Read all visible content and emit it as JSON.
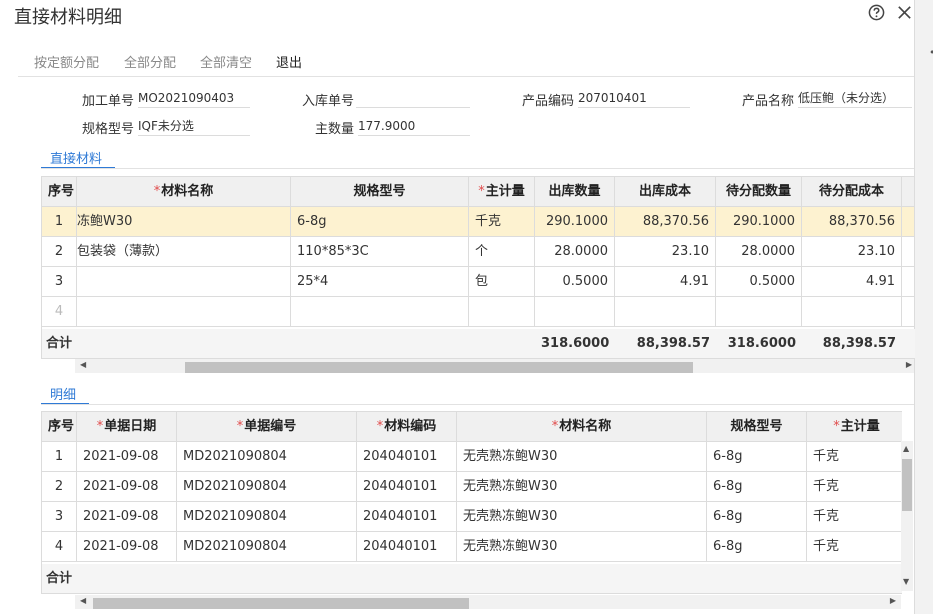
{
  "dialog": {
    "title": "直接材料明细"
  },
  "toolbar": {
    "quota_alloc": "按定额分配",
    "alloc_all": "全部分配",
    "clear_all": "全部清空",
    "exit": "退出"
  },
  "form": {
    "process_no_label": "加工单号",
    "process_no": "MO2021090403",
    "inbound_no_label": "入库单号",
    "inbound_no": "",
    "product_code_label": "产品编码",
    "product_code": "207010401",
    "product_name_label": "产品名称",
    "product_name": "低压鲍（未分选）",
    "spec_label": "规格型号",
    "spec": "IQF未分选",
    "main_qty_label": "主数量",
    "main_qty": "177.9000"
  },
  "materials": {
    "tab": "直接材料",
    "headers": [
      "序号",
      "材料名称",
      "规格型号",
      "主计量",
      "出库数量",
      "出库成本",
      "待分配数量",
      "待分配成本"
    ],
    "rows": [
      [
        "1",
        "冻鲍W30",
        "6-8g",
        "千克",
        "290.1000",
        "88,370.56",
        "290.1000",
        "88,370.56"
      ],
      [
        "2",
        "包装袋（薄款）",
        "110*85*3C",
        "个",
        "28.0000",
        "23.10",
        "28.0000",
        "23.10"
      ],
      [
        "3",
        "",
        "25*4",
        "包",
        "0.5000",
        "4.91",
        "0.5000",
        "4.91"
      ],
      [
        "4",
        "",
        "",
        "",
        "",
        "",
        "",
        ""
      ]
    ],
    "total_label": "合计",
    "totals": [
      "318.6000",
      "88,398.57",
      "318.6000",
      "88,398.57"
    ]
  },
  "details": {
    "tab": "明细",
    "headers": [
      "序号",
      "单据日期",
      "单据编号",
      "材料编码",
      "材料名称",
      "规格型号",
      "主计量"
    ],
    "rows": [
      [
        "1",
        "2021-09-08",
        "MD2021090804",
        "204040101",
        "无壳熟冻鲍W30",
        "6-8g",
        "千克"
      ],
      [
        "2",
        "2021-09-08",
        "MD2021090804",
        "204040101",
        "无壳熟冻鲍W30",
        "6-8g",
        "千克"
      ],
      [
        "3",
        "2021-09-08",
        "MD2021090804",
        "204040101",
        "无壳熟冻鲍W30",
        "6-8g",
        "千克"
      ],
      [
        "4",
        "2021-09-08",
        "MD2021090804",
        "204040101",
        "无壳熟冻鲍W30",
        "6-8g",
        "千克"
      ]
    ],
    "total_label": "合计"
  },
  "colors": {
    "accent": "#2f7ad6",
    "required": "#e04a4a",
    "selected_row": "#fdf2d0",
    "header_bg": "#f0f0f0"
  },
  "icons": {
    "help": "help-circle-icon",
    "close": "close-icon"
  }
}
